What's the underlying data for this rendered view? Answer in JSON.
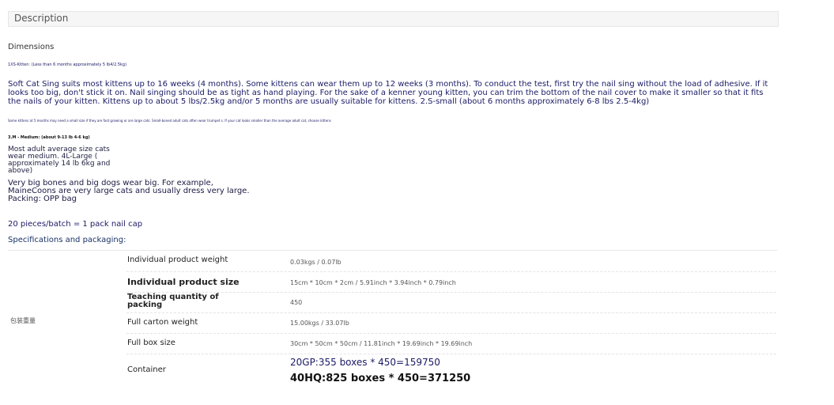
{
  "description_tab": {
    "label": "Description"
  },
  "dimensions": {
    "heading": "Dimensions",
    "kitten_note": "1XS-Kitten: (Less than 6 months approximately 5 lb4/2.5kg)",
    "main_paragraph": "Soft Cat Sing suits most kittens up to 16 weeks (4 months). Some kittens can wear them up to 12 weeks (3 months). To conduct the test, first try the nail sing without the load of adhesive. If it looks too big, don't stick it on. Nail singing should be as tight as hand playing. For the sake of a kenner young kitten, you can trim the bottom of the nail cover to make it smaller so that it fits the nails of your kitten. Kittens up to about 5 lbs/2.5kg and/or 5 months are usually suitable for kittens. 2.S-small (about 6 months approximately 6-8 lbs 2.5-4kg)",
    "tiny_note": "Some kittens at 5 months may need a small size if they are fast growing or are large cats. Small-boned adult cats often wear trumpet s. If your cat looks smaller than the average adult cat, choose kittens",
    "medium_heading": "3.M - Medium: (about 9-13 lb 4-6 kg)",
    "adult_text": "Most adult average size cats wear medium. 4L-Large ( approximately 14 lb 6kg and above)",
    "bones_text": "Very big bones and big dogs wear big. For example, MaineCoons are very large cats and usually dress very large.",
    "packing_text": "Packing: OPP bag",
    "batch_text": "20 pieces/batch = 1 pack nail cap"
  },
  "specs": {
    "heading": "Specifications and packaging:",
    "side_label": "包装重量",
    "rows": [
      {
        "label": "Individual product weight",
        "value": "0.03kgs / 0.07lb"
      },
      {
        "label": "Individual product size",
        "value": "15cm * 10cm * 2cm / 5.91inch * 3.94inch * 0.79inch"
      },
      {
        "label": "Teaching quantity of packing",
        "value": "450"
      },
      {
        "label": "Full carton weight",
        "value": "15.00kgs / 33.07lb"
      },
      {
        "label": "Full box size",
        "value": "30cm * 50cm * 50cm / 11.81inch * 19.69inch * 19.69inch"
      }
    ],
    "container": {
      "label": "Container",
      "line1": "20GP:355 boxes * 450=159750",
      "line2": "40HQ:825 boxes * 450=371250"
    }
  }
}
